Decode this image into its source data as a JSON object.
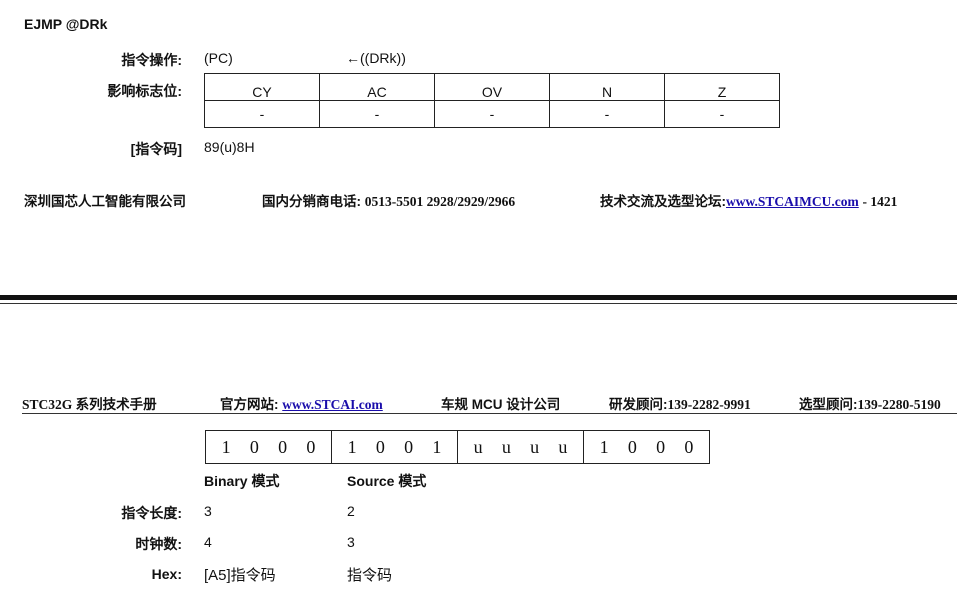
{
  "title": "EJMP @DRk",
  "operation": {
    "label": "指令操作:",
    "dest": "(PC)",
    "expr": "←((DRk))"
  },
  "flags": {
    "label": "影响标志位:",
    "headers": [
      "CY",
      "AC",
      "OV",
      "N",
      "Z"
    ],
    "values": [
      "-",
      "-",
      "-",
      "-",
      "-"
    ]
  },
  "opcode": {
    "label": "[指令码]",
    "value": "89(u)8H"
  },
  "footer": {
    "company": "深圳国芯人工智能有限公司",
    "phone_label": "国内分销商电话:",
    "phone_value": "0513-5501 2928/2929/2966",
    "forum_label": "技术交流及选型论坛:",
    "forum_link": "www.STCAIMCU.com",
    "forum_tail": "- 1421"
  },
  "page_header": {
    "manual": "STC32G 系列技术手册",
    "site_label": "官方网站:",
    "site_link": "www.STCAI.com",
    "company": "车规 MCU 设计公司",
    "rd_label": "研发顾问:",
    "rd_value": "139-2282-9991",
    "sel_label": "选型顾问:",
    "sel_value": "139-2280-5190"
  },
  "bit_groups": [
    [
      "1",
      "0",
      "0",
      "0"
    ],
    [
      "1",
      "0",
      "0",
      "1"
    ],
    [
      "u",
      "u",
      "u",
      "u"
    ],
    [
      "1",
      "0",
      "0",
      "0"
    ]
  ],
  "modes": {
    "binary_header": "Binary 模式",
    "source_header": "Source 模式",
    "rows": [
      {
        "label": "指令长度:",
        "binary": "3",
        "source": "2"
      },
      {
        "label": "时钟数:",
        "binary": "4",
        "source": "3"
      },
      {
        "label": "Hex:",
        "binary": "[A5]指令码",
        "source": "指令码"
      }
    ]
  }
}
